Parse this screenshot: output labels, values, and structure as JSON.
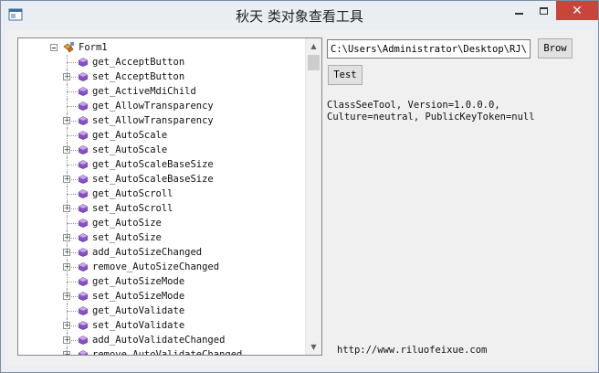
{
  "window": {
    "title": "秋天 类对象查看工具",
    "minimize_label": "—",
    "maximize_label": "□",
    "close_label": "✕"
  },
  "tree": {
    "root_label": "Form1",
    "items": [
      {
        "label": "get_AcceptButton",
        "expandable": false
      },
      {
        "label": "set_AcceptButton",
        "expandable": true
      },
      {
        "label": "get_ActiveMdiChild",
        "expandable": false
      },
      {
        "label": "get_AllowTransparency",
        "expandable": false
      },
      {
        "label": "set_AllowTransparency",
        "expandable": true
      },
      {
        "label": "get_AutoScale",
        "expandable": false
      },
      {
        "label": "set_AutoScale",
        "expandable": true
      },
      {
        "label": "get_AutoScaleBaseSize",
        "expandable": false
      },
      {
        "label": "set_AutoScaleBaseSize",
        "expandable": true
      },
      {
        "label": "get_AutoScroll",
        "expandable": false
      },
      {
        "label": "set_AutoScroll",
        "expandable": true
      },
      {
        "label": "get_AutoSize",
        "expandable": false
      },
      {
        "label": "set_AutoSize",
        "expandable": true
      },
      {
        "label": "add_AutoSizeChanged",
        "expandable": true
      },
      {
        "label": "remove_AutoSizeChanged",
        "expandable": true
      },
      {
        "label": "get_AutoSizeMode",
        "expandable": false
      },
      {
        "label": "set_AutoSizeMode",
        "expandable": true
      },
      {
        "label": "get_AutoValidate",
        "expandable": false
      },
      {
        "label": "set_AutoValidate",
        "expandable": true
      },
      {
        "label": "add_AutoValidateChanged",
        "expandable": true
      },
      {
        "label": "remove_AutoValidateChanged",
        "expandable": true
      }
    ]
  },
  "path_input": {
    "value": "C:\\Users\\Administrator\\Desktop\\RJ\\自"
  },
  "buttons": {
    "browse": "Brow",
    "test": "Test"
  },
  "info": {
    "assembly": "ClassSeeTool, Version=1.0.0.0,\nCulture=neutral, PublicKeyToken=null"
  },
  "footer": {
    "url": "http://www.riluofeixue.com"
  },
  "colors": {
    "close_button": "#c8453a",
    "method_icon": "#8a4fc9",
    "titlebar": "#eaeef3"
  }
}
